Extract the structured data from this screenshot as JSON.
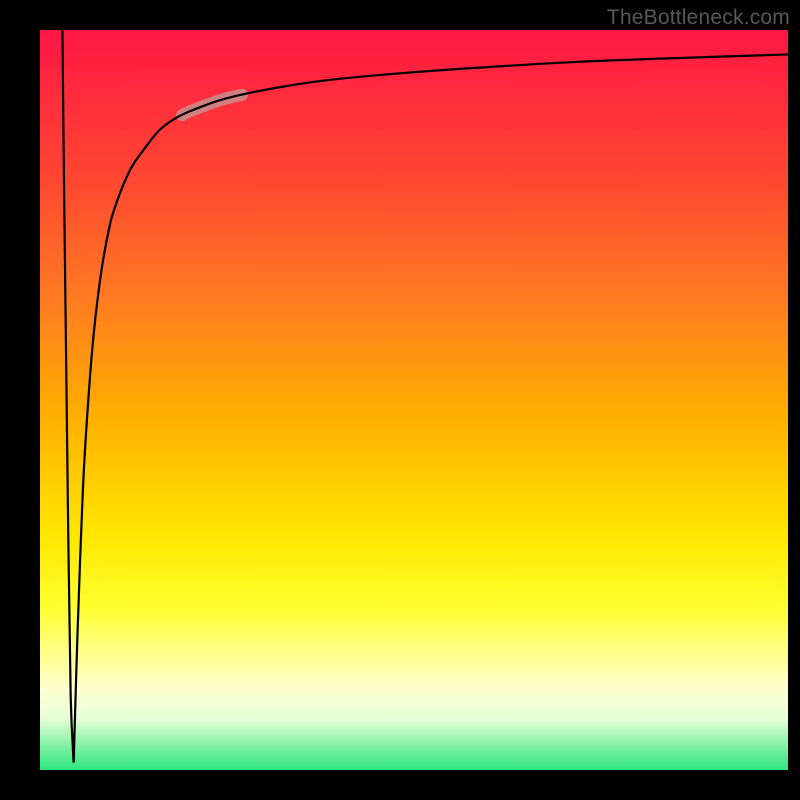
{
  "watermark": "TheBottleneck.com",
  "colors": {
    "frame": "#000000",
    "curve": "#000000",
    "marker": "#c7928f",
    "gradient_top": "#ff1744",
    "gradient_mid": "#ffe600",
    "gradient_bottom": "#2de57f"
  },
  "chart_data": {
    "type": "line",
    "title": "",
    "xlabel": "",
    "ylabel": "",
    "xlim": [
      0,
      100
    ],
    "ylim": [
      0,
      100
    ],
    "grid": false,
    "background": "vertical-gradient-red-to-green",
    "annotations": [
      {
        "name": "highlight-segment",
        "x_start": 19,
        "x_end": 27,
        "style": "thick-muted-rose"
      }
    ],
    "series": [
      {
        "name": "bottleneck-curve-down-branch",
        "x": [
          3.0,
          3.2,
          3.5,
          3.8,
          4.1,
          4.5
        ],
        "y": [
          100,
          80,
          55,
          30,
          10,
          1
        ]
      },
      {
        "name": "bottleneck-curve-up-branch",
        "x": [
          4.5,
          5.0,
          5.5,
          6.0,
          7.0,
          8.0,
          9.0,
          10.0,
          12.0,
          14.0,
          16.0,
          18.0,
          20.0,
          24.0,
          28.0,
          34.0,
          40.0,
          50.0,
          60.0,
          72.0,
          85.0,
          100.0
        ],
        "y": [
          1,
          18,
          32,
          43,
          57,
          66,
          72,
          76,
          81,
          84,
          86.5,
          88,
          89,
          90.5,
          91.5,
          92.6,
          93.4,
          94.3,
          95.0,
          95.7,
          96.2,
          96.7
        ]
      }
    ]
  }
}
